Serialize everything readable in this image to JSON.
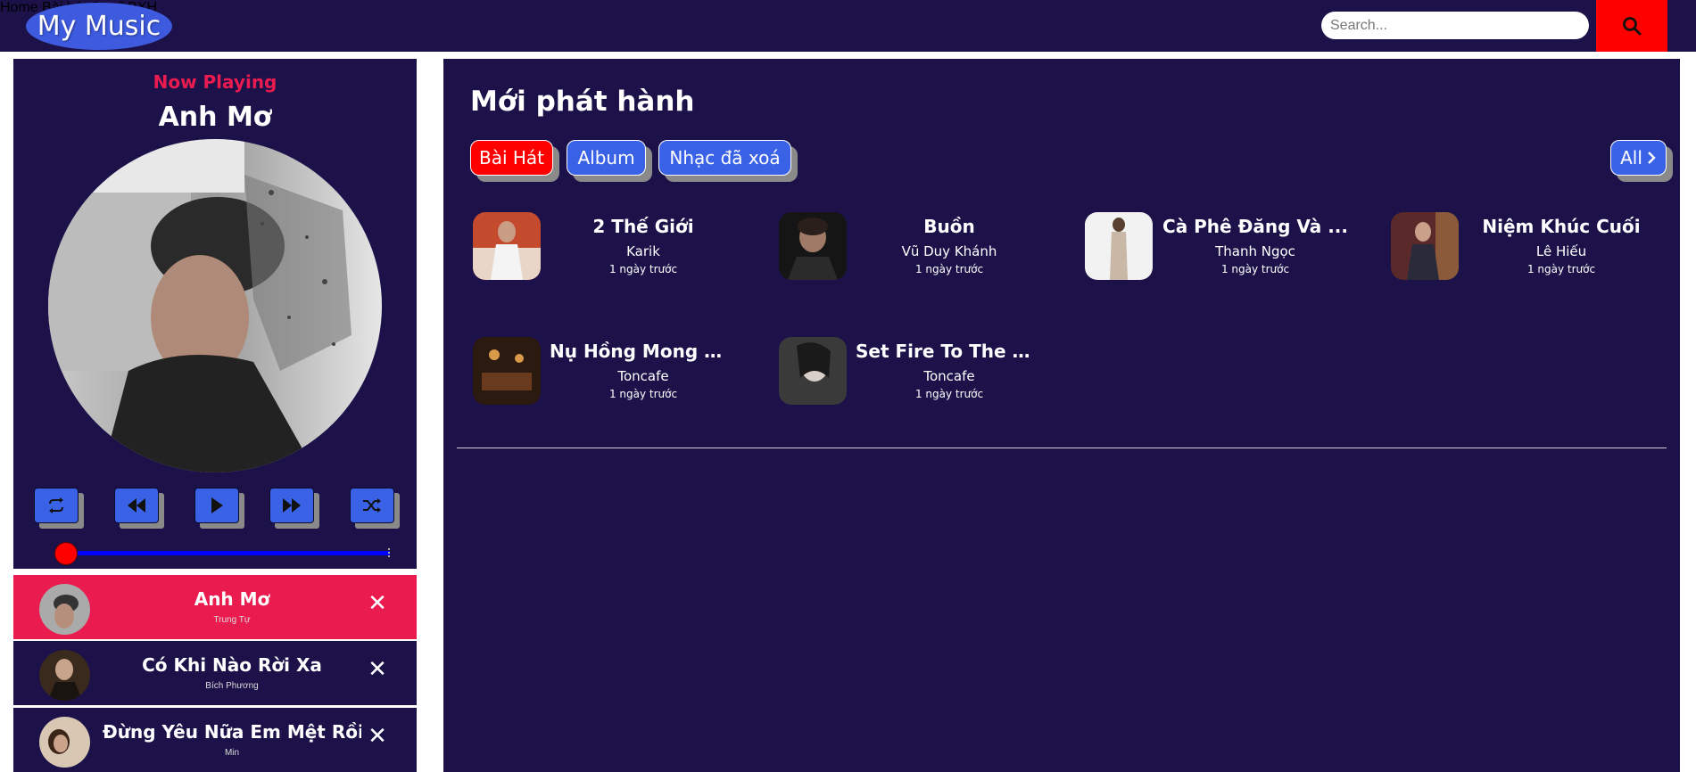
{
  "header": {
    "logo": "My Music",
    "nav": [
      "Home",
      "Bài hát",
      "Ca sĩ",
      "BXH"
    ],
    "search_placeholder": "Search...",
    "search_icon": "search-icon",
    "accent": "#ff0000",
    "bg": "#1c1249"
  },
  "player": {
    "label": "Now Playing",
    "title": "Anh Mơ",
    "controls": [
      "repeat-icon",
      "rewind-icon",
      "play-icon",
      "fast-forward-icon",
      "shuffle-icon"
    ],
    "progress": 0
  },
  "queue": [
    {
      "title": "Anh Mơ",
      "artist": "Trung Tự",
      "active": true
    },
    {
      "title": "Có Khi Nào Rời Xa",
      "artist": "Bích Phương",
      "active": false
    },
    {
      "title": "Đừng Yêu Nữa Em Mệt Rồi",
      "artist": "Min",
      "active": false
    }
  ],
  "main": {
    "title": "Mới phát hành",
    "tabs": [
      "Bài Hát",
      "Album",
      "Nhạc đã xoá"
    ],
    "all_label": "All",
    "songs": [
      {
        "title": "2 Thế Giới",
        "artist": "Karik",
        "time": "1 ngày trước"
      },
      {
        "title": "Buồn",
        "artist": "Vũ Duy Khánh",
        "time": "1 ngày trước"
      },
      {
        "title": "Cà Phê Đăng Và ...",
        "artist": "Thanh Ngọc",
        "time": "1 ngày trước"
      },
      {
        "title": "Niệm Khúc Cuối",
        "artist": "Lê Hiếu",
        "time": "1 ngày trước"
      },
      {
        "title": "Nụ Hồng Mong Ma...",
        "artist": "Toncafe",
        "time": "1 ngày trước"
      },
      {
        "title": "Set Fire To The Rain",
        "artist": "Toncafe",
        "time": "1 ngày trước"
      }
    ]
  }
}
